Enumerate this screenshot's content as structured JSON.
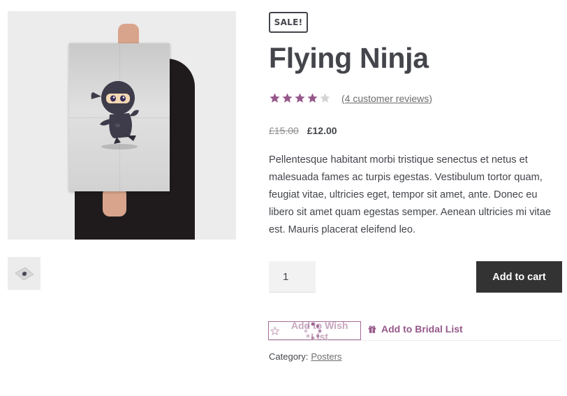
{
  "product": {
    "badge": "SALE!",
    "title": "Flying Ninja",
    "rating": {
      "value": 4,
      "max": 5,
      "reviews_label": "(4 customer reviews)"
    },
    "price": {
      "old": "£15.00",
      "new": "£12.00"
    },
    "description": "Pellentesque habitant morbi tristique senectus et netus et malesuada fames ac turpis egestas. Vestibulum tortor quam, feugiat vitae, ultricies eget, tempor sit amet, ante. Donec eu libero sit amet quam egestas semper. Aenean ultricies mi vitae est. Mauris placerat eleifend leo.",
    "quantity": "1",
    "add_to_cart_label": "Add to cart",
    "wishlist_label": "Add to Wish List",
    "bridal_label": "Add to Bridal List",
    "category_label": "Category:",
    "category_value": "Posters"
  },
  "colors": {
    "accent": "#96588a",
    "star_filled": "#96588a",
    "star_empty": "#d4d4d4",
    "button_bg": "#333333",
    "text": "#43454b"
  },
  "icons": {
    "rating": "star-icon",
    "wishlist": "star-outline-icon",
    "loading": "spinner-icon",
    "bridal": "gift-icon"
  }
}
